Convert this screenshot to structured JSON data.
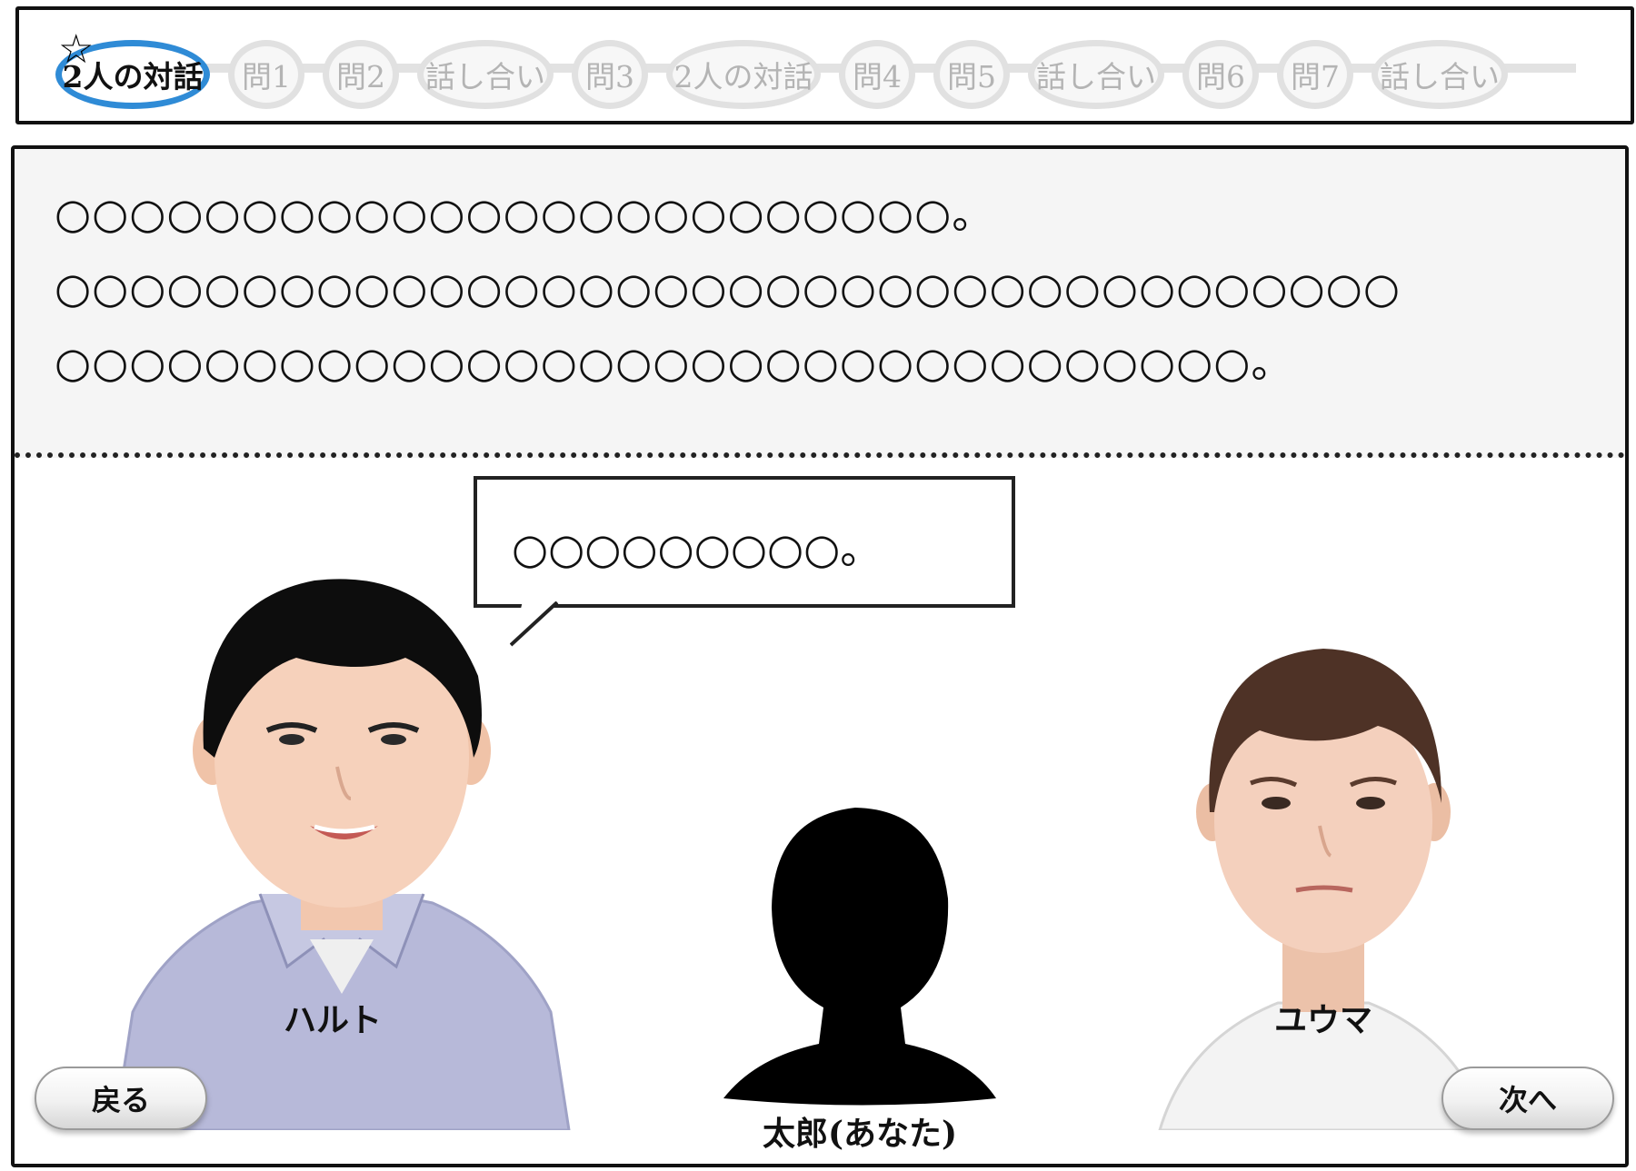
{
  "progress": {
    "current_marker_icon": "star-icon",
    "steps": [
      {
        "label": "2人の対話",
        "state": "active"
      },
      {
        "label": "問1",
        "state": "inactive"
      },
      {
        "label": "問2",
        "state": "inactive"
      },
      {
        "label": "話し合い",
        "state": "inactive"
      },
      {
        "label": "問3",
        "state": "inactive"
      },
      {
        "label": "2人の対話",
        "state": "inactive"
      },
      {
        "label": "問4",
        "state": "inactive"
      },
      {
        "label": "問5",
        "state": "inactive"
      },
      {
        "label": "話し合い",
        "state": "inactive"
      },
      {
        "label": "問6",
        "state": "inactive"
      },
      {
        "label": "問7",
        "state": "inactive"
      },
      {
        "label": "話し合い",
        "state": "inactive"
      }
    ]
  },
  "narration": {
    "lines": [
      "○○○○○○○○○○○○○○○○○○○○○○○○。",
      "○○○○○○○○○○○○○○○○○○○○○○○○○○○○○○○○○○○○",
      "○○○○○○○○○○○○○○○○○○○○○○○○○○○○○○○○。"
    ]
  },
  "speech_bubble": {
    "text": "○○○○○○○○○。",
    "speaker": "ハルト"
  },
  "characters": {
    "left": {
      "name": "ハルト"
    },
    "center": {
      "name": "太郎(あなた)"
    },
    "right": {
      "name": "ユウマ"
    }
  },
  "navigation": {
    "back_label": "戻る",
    "next_label": "次へ"
  },
  "colors": {
    "active_step_border": "#2f8bd6",
    "inactive_step_border": "#e1e1e1",
    "narration_background": "#f5f5f5"
  }
}
